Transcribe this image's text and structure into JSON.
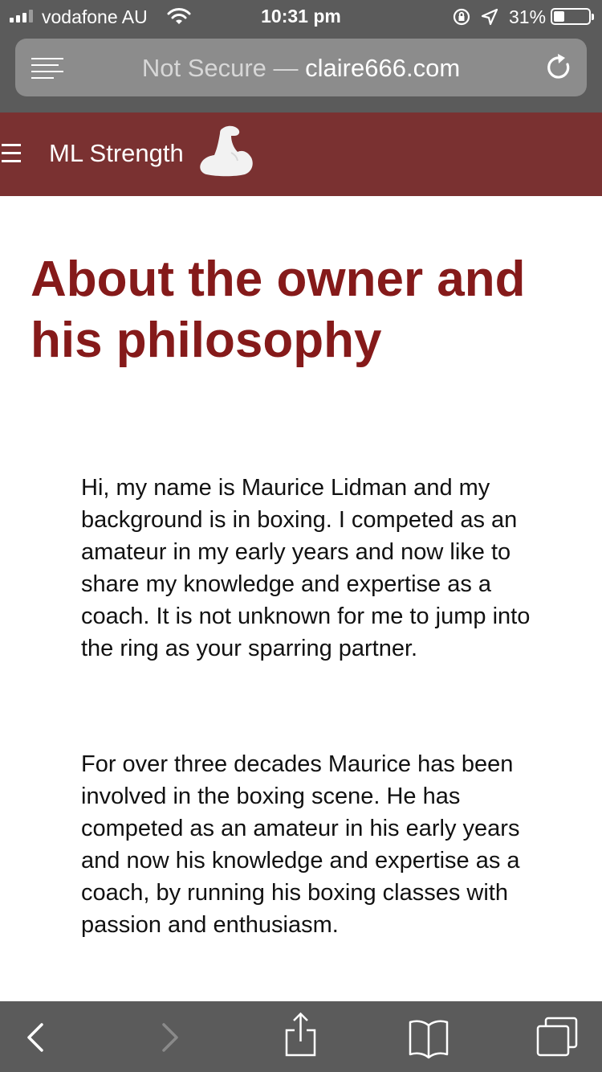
{
  "status": {
    "carrier": "vodafone AU",
    "time": "10:31 pm",
    "battery_percent": "31%",
    "battery_level": 0.31,
    "signal_bars_filled": 3,
    "signal_bars_total": 4
  },
  "browser": {
    "url_prefix": "Not Secure —",
    "url_domain": "claire666.com",
    "reader_icon": "reader-lines-icon",
    "reload_icon": "reload-icon"
  },
  "site": {
    "brand": "ML Strength",
    "menu_icon": "hamburger-icon",
    "logo_icon": "flexed-bicep-icon",
    "header_color": "#7a3131"
  },
  "content": {
    "title": "About the owner and his philosophy",
    "title_color": "#851a1a",
    "paragraphs": [
      "Hi, my name is Maurice Lidman and my background is in boxing. I competed as an amateur in my early years and now like to share my knowledge and expertise as a coach. It is not unknown for me to jump into the ring as your sparring partner.",
      "For over three decades Maurice has been involved in the boxing scene. He has competed as an amateur in his early years and now his knowledge and expertise as a coach, by running his boxing classes with passion and enthusiasm."
    ]
  },
  "toolbar": {
    "back_icon": "back-chevron-icon",
    "forward_icon": "forward-chevron-icon",
    "share_icon": "share-icon",
    "bookmarks_icon": "bookmarks-book-icon",
    "tabs_icon": "tabs-icon"
  }
}
